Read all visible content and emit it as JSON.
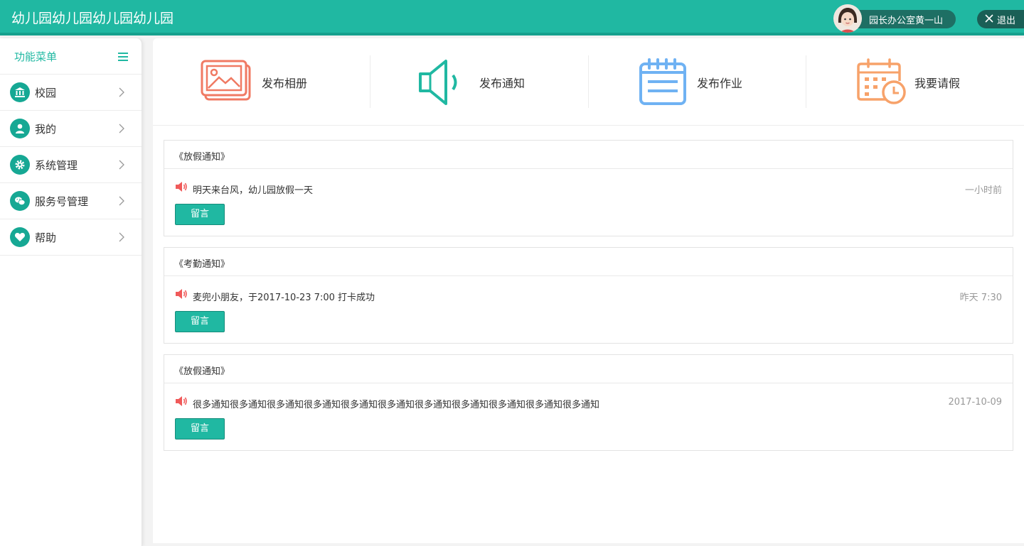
{
  "header": {
    "app_title": "幼儿园幼儿园幼儿园幼儿园",
    "user_name": "园长办公室黄一山",
    "logout_label": "退出",
    "brand_color": "#20b8a2"
  },
  "sidebar": {
    "title": "功能菜单",
    "items": [
      {
        "label": "校园",
        "icon": "bank-icon"
      },
      {
        "label": "我的",
        "icon": "user-icon"
      },
      {
        "label": "系统管理",
        "icon": "gear-icon"
      },
      {
        "label": "服务号管理",
        "icon": "wechat-icon"
      },
      {
        "label": "帮助",
        "icon": "heart-icon"
      }
    ]
  },
  "quick_actions": [
    {
      "label": "发布相册",
      "icon": "photo-album-icon",
      "color": "#f07a63"
    },
    {
      "label": "发布通知",
      "icon": "megaphone-icon",
      "color": "#20b8a2"
    },
    {
      "label": "发布作业",
      "icon": "notepad-icon",
      "color": "#6fb2f3"
    },
    {
      "label": "我要请假",
      "icon": "calendar-clock-icon",
      "color": "#f7a26a"
    }
  ],
  "notices": [
    {
      "title": "《放假通知》",
      "text": "明天来台风，幼儿园放假一天",
      "time": "一小时前",
      "button": "留言"
    },
    {
      "title": "《考勤通知》",
      "text": "麦兜小朋友，于2017-10-23 7:00 打卡成功",
      "time": "昨天 7:30",
      "button": "留言"
    },
    {
      "title": "《放假通知》",
      "text": "很多通知很多通知很多通知很多通知很多通知很多通知很多通知很多通知很多通知很多通知很多通知",
      "time": "2017-10-09",
      "button": "留言"
    }
  ]
}
